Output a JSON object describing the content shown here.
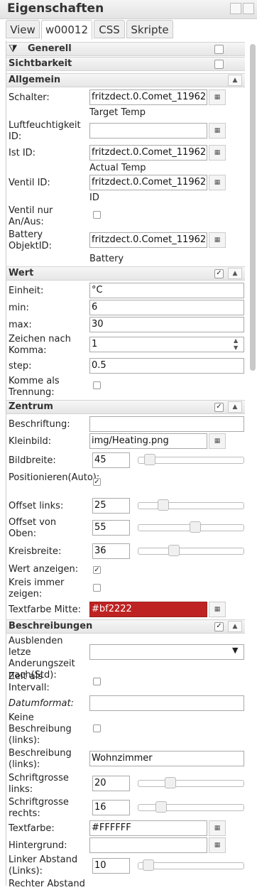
{
  "title": "Eigenschaften",
  "tabs": [
    "View",
    "w00012",
    "CSS",
    "Skripte"
  ],
  "sections": {
    "generell": "Generell",
    "sichtbarkeit": "Sichtbarkeit",
    "allgemein": "Allgemein",
    "wert": "Wert",
    "zentrum": "Zentrum",
    "beschreibungen": "Beschreibungen"
  },
  "fields": {
    "schalter": {
      "label": "Schalter:",
      "value": "fritzdect.0.Comet_11962",
      "sub": "Target Temp"
    },
    "luftfeuchtigkeit": {
      "label": "Luftfeuchtigkeit ID:",
      "value": ""
    },
    "ist_id": {
      "label": "Ist ID:",
      "value": "fritzdect.0.Comet_11962",
      "sub": "Actual Temp"
    },
    "ventil_id": {
      "label": "Ventil ID:",
      "value": "fritzdect.0.Comet_11962",
      "sub": "ID"
    },
    "ventil_nur": {
      "label": "Ventil nur An/Aus:"
    },
    "battery": {
      "label": "Battery ObjektID:",
      "value": "fritzdect.0.Comet_11962",
      "sub": "Battery"
    },
    "einheit": {
      "label": "Einheit:",
      "value": "°C"
    },
    "min": {
      "label": "min:",
      "value": "6"
    },
    "max": {
      "label": "max:",
      "value": "30"
    },
    "zeichen": {
      "label": "Zeichen nach Komma:",
      "value": "1"
    },
    "step": {
      "label": "step:",
      "value": "0.5"
    },
    "komme": {
      "label": "Komme als Trennung:"
    },
    "beschriftung": {
      "label": "Beschriftung:",
      "value": ""
    },
    "kleinbild": {
      "label": "Kleinbild:",
      "value": "img/Heating.png"
    },
    "bildbreite": {
      "label": "Bildbreite:",
      "value": "45"
    },
    "positionieren": {
      "label": "Positionieren(Auto):"
    },
    "offset_links": {
      "label": "Offset links:",
      "value": "25"
    },
    "offset_oben": {
      "label": "Offset von Oben:",
      "value": "55"
    },
    "kreisbreite": {
      "label": "Kreisbreite:",
      "value": "36"
    },
    "wert_anzeigen": {
      "label": "Wert anzeigen:"
    },
    "kreis_immer": {
      "label": "Kreis immer zeigen:"
    },
    "textfarbe_mitte": {
      "label": "Textfarbe Mitte:",
      "value": "#bf2222"
    },
    "ausblenden": {
      "label": "Ausblenden letze Anderungszeit nach(Std):",
      "value": ""
    },
    "zeit_intervall": {
      "label": "Zeit als Intervall:"
    },
    "datumformat": {
      "label": "Datumformat:",
      "value": ""
    },
    "keine_beschreibung": {
      "label": "Keine Beschreibung (links):"
    },
    "beschreibung_links": {
      "label": "Beschreibung (links):",
      "value": "Wohnzimmer"
    },
    "schriftgrosse_links": {
      "label": "Schriftgrosse links:",
      "value": "20"
    },
    "schriftgrosse_rechts": {
      "label": "Schriftgrosse rechts:",
      "value": "16"
    },
    "textfarbe": {
      "label": "Textfarbe:",
      "value": "#FFFFFF"
    },
    "hintergrund": {
      "label": "Hintergrund:",
      "value": ""
    },
    "linker_abstand": {
      "label": "Linker Abstand (Links):",
      "value": "10"
    },
    "rechter_abstand": {
      "label": "Rechter Abstand"
    }
  },
  "colors": {
    "textfarbe_mitte": "#bf2222"
  }
}
